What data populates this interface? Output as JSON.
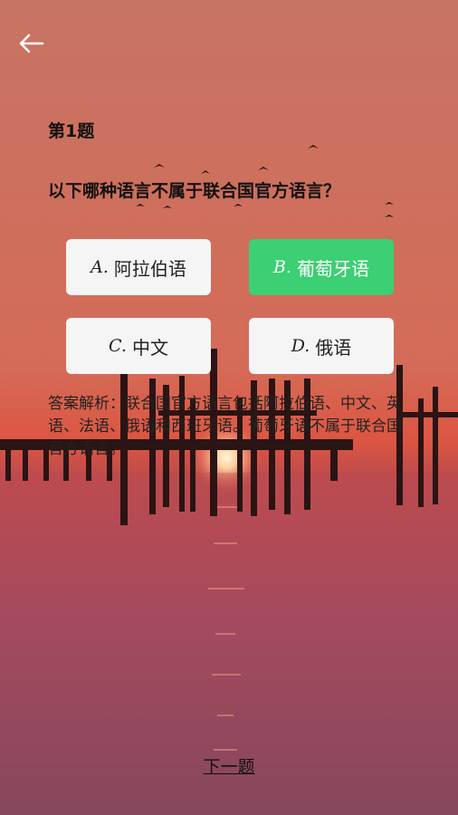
{
  "header": {
    "back_icon": "arrow-left-icon"
  },
  "question": {
    "number": "第1题",
    "text": "以下哪种语言不属于联合国官方语言？"
  },
  "options": [
    {
      "letter": "A.",
      "label": "阿拉伯语",
      "selected": false
    },
    {
      "letter": "B.",
      "label": "葡萄牙语",
      "selected": true
    },
    {
      "letter": "C.",
      "label": "中文",
      "selected": false
    },
    {
      "letter": "D.",
      "label": "俄语",
      "selected": false
    }
  ],
  "analysis": {
    "text": "答案解析：联合国官方语言包括阿拉伯语、中文、英语、法语、俄语和西班牙语。葡萄牙语不属于联合国官方语言。"
  },
  "footer": {
    "next_label": "下一题"
  },
  "colors": {
    "selected": "#3ccf73",
    "option_bg": "#f5f5f5"
  }
}
